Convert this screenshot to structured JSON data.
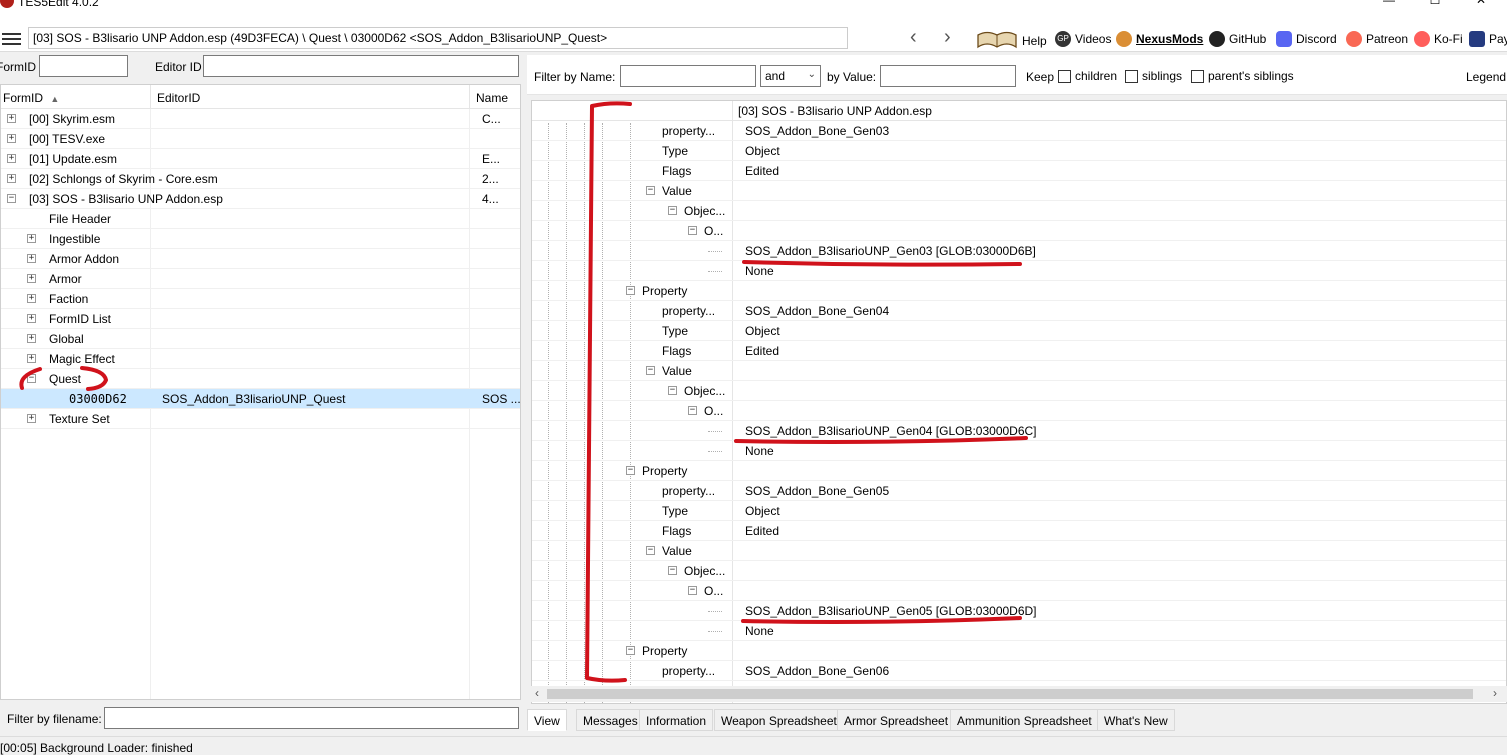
{
  "window": {
    "title": "TES5Edit 4.0.2",
    "minimize_glyph": "—",
    "maximize_glyph": "☐",
    "close_glyph": "✕"
  },
  "toolbar": {
    "path": "[03] SOS - B3lisario UNP Addon.esp (49D3FECA) \\ Quest \\ 03000D62 <SOS_Addon_B3lisarioUNP_Quest>",
    "back_glyph": "‹",
    "forward_glyph": "›",
    "links": [
      {
        "label": "Help",
        "icon": "book-icon"
      },
      {
        "label": "Videos",
        "icon": "gp-icon"
      },
      {
        "label": "NexusMods",
        "icon": "nexusmods-icon"
      },
      {
        "label": "GitHub",
        "icon": "github-icon"
      },
      {
        "label": "Discord",
        "icon": "discord-icon"
      },
      {
        "label": "Patreon",
        "icon": "patreon-icon"
      },
      {
        "label": "Ko-Fi",
        "icon": "kofi-icon"
      },
      {
        "label": "Pay",
        "icon": "paypal-icon"
      }
    ]
  },
  "left": {
    "formid_label": "FormID",
    "editorid_label": "Editor ID",
    "columns": [
      "FormID",
      "EditorID",
      "Name"
    ],
    "sort_glyph": "▲",
    "tree": [
      {
        "label": "[00] Skyrim.esm",
        "name": "C...",
        "expander": "+"
      },
      {
        "label": "[00] TESV.exe",
        "name": "",
        "expander": "+"
      },
      {
        "label": "[01] Update.esm",
        "name": "E...",
        "expander": "+"
      },
      {
        "label": "[02] Schlongs of Skyrim - Core.esm",
        "name": "2...",
        "expander": "+"
      },
      {
        "label": "[03] SOS - B3lisario UNP Addon.esp",
        "name": "4...",
        "expander": "−"
      },
      {
        "label": "File Header",
        "name": "",
        "expander": ""
      },
      {
        "label": "Ingestible",
        "name": "",
        "expander": "+"
      },
      {
        "label": "Armor Addon",
        "name": "",
        "expander": "+"
      },
      {
        "label": "Armor",
        "name": "",
        "expander": "+"
      },
      {
        "label": "Faction",
        "name": "",
        "expander": "+"
      },
      {
        "label": "FormID List",
        "name": "",
        "expander": "+"
      },
      {
        "label": "Global",
        "name": "",
        "expander": "+"
      },
      {
        "label": "Magic Effect",
        "name": "",
        "expander": "+"
      },
      {
        "label": "Quest",
        "name": "",
        "expander": "−"
      },
      {
        "label": "03000D62",
        "editorid": "SOS_Addon_B3lisarioUNP_Quest",
        "name": "SOS ...",
        "expander": ""
      },
      {
        "label": "Texture Set",
        "name": "",
        "expander": "+"
      }
    ],
    "filter_label": "Filter by filename:"
  },
  "right": {
    "filter_name_label": "Filter by Name:",
    "operator": "and",
    "filter_value_label": "by Value:",
    "keep_label": "Keep",
    "children_label": "children",
    "siblings_label": "siblings",
    "parents_siblings_label": "parent's siblings",
    "legend_label": "Legend",
    "header_value": "[03] SOS - B3lisario UNP Addon.esp",
    "rows": [
      {
        "name": "property...",
        "value": "SOS_Addon_Bone_Gen03",
        "exp": ""
      },
      {
        "name": "Type",
        "value": "Object",
        "exp": ""
      },
      {
        "name": "Flags",
        "value": "Edited",
        "exp": ""
      },
      {
        "name": "Value",
        "value": "",
        "exp": "−"
      },
      {
        "name": "Objec...",
        "value": "",
        "exp": "−"
      },
      {
        "name": "O...",
        "value": "",
        "exp": "−"
      },
      {
        "name": "",
        "value": "SOS_Addon_B3lisarioUNP_Gen03 [GLOB:03000D6B]",
        "exp": ""
      },
      {
        "name": "",
        "value": "None",
        "exp": ""
      },
      {
        "name": "Property",
        "value": "",
        "exp": "−"
      },
      {
        "name": "property...",
        "value": "SOS_Addon_Bone_Gen04",
        "exp": ""
      },
      {
        "name": "Type",
        "value": "Object",
        "exp": ""
      },
      {
        "name": "Flags",
        "value": "Edited",
        "exp": ""
      },
      {
        "name": "Value",
        "value": "",
        "exp": "−"
      },
      {
        "name": "Objec...",
        "value": "",
        "exp": "−"
      },
      {
        "name": "O...",
        "value": "",
        "exp": "−"
      },
      {
        "name": "",
        "value": "SOS_Addon_B3lisarioUNP_Gen04 [GLOB:03000D6C]",
        "exp": ""
      },
      {
        "name": "",
        "value": "None",
        "exp": ""
      },
      {
        "name": "Property",
        "value": "",
        "exp": "−"
      },
      {
        "name": "property...",
        "value": "SOS_Addon_Bone_Gen05",
        "exp": ""
      },
      {
        "name": "Type",
        "value": "Object",
        "exp": ""
      },
      {
        "name": "Flags",
        "value": "Edited",
        "exp": ""
      },
      {
        "name": "Value",
        "value": "",
        "exp": "−"
      },
      {
        "name": "Objec...",
        "value": "",
        "exp": "−"
      },
      {
        "name": "O...",
        "value": "",
        "exp": "−"
      },
      {
        "name": "",
        "value": "SOS_Addon_B3lisarioUNP_Gen05 [GLOB:03000D6D]",
        "exp": ""
      },
      {
        "name": "",
        "value": "None",
        "exp": ""
      },
      {
        "name": "Property",
        "value": "",
        "exp": "−"
      },
      {
        "name": "property...",
        "value": "SOS_Addon_Bone_Gen06",
        "exp": ""
      }
    ],
    "scroll_left_glyph": "‹",
    "scroll_right_glyph": "›"
  },
  "tabs": [
    "View",
    "Messages",
    "Information",
    "Weapon Spreadsheet",
    "Armor Spreadsheet",
    "Ammunition Spreadsheet",
    "What's New"
  ],
  "status": "[00:05] Background Loader: finished",
  "colors": {
    "annotation": "#d0121b",
    "selection": "#cce8ff"
  }
}
